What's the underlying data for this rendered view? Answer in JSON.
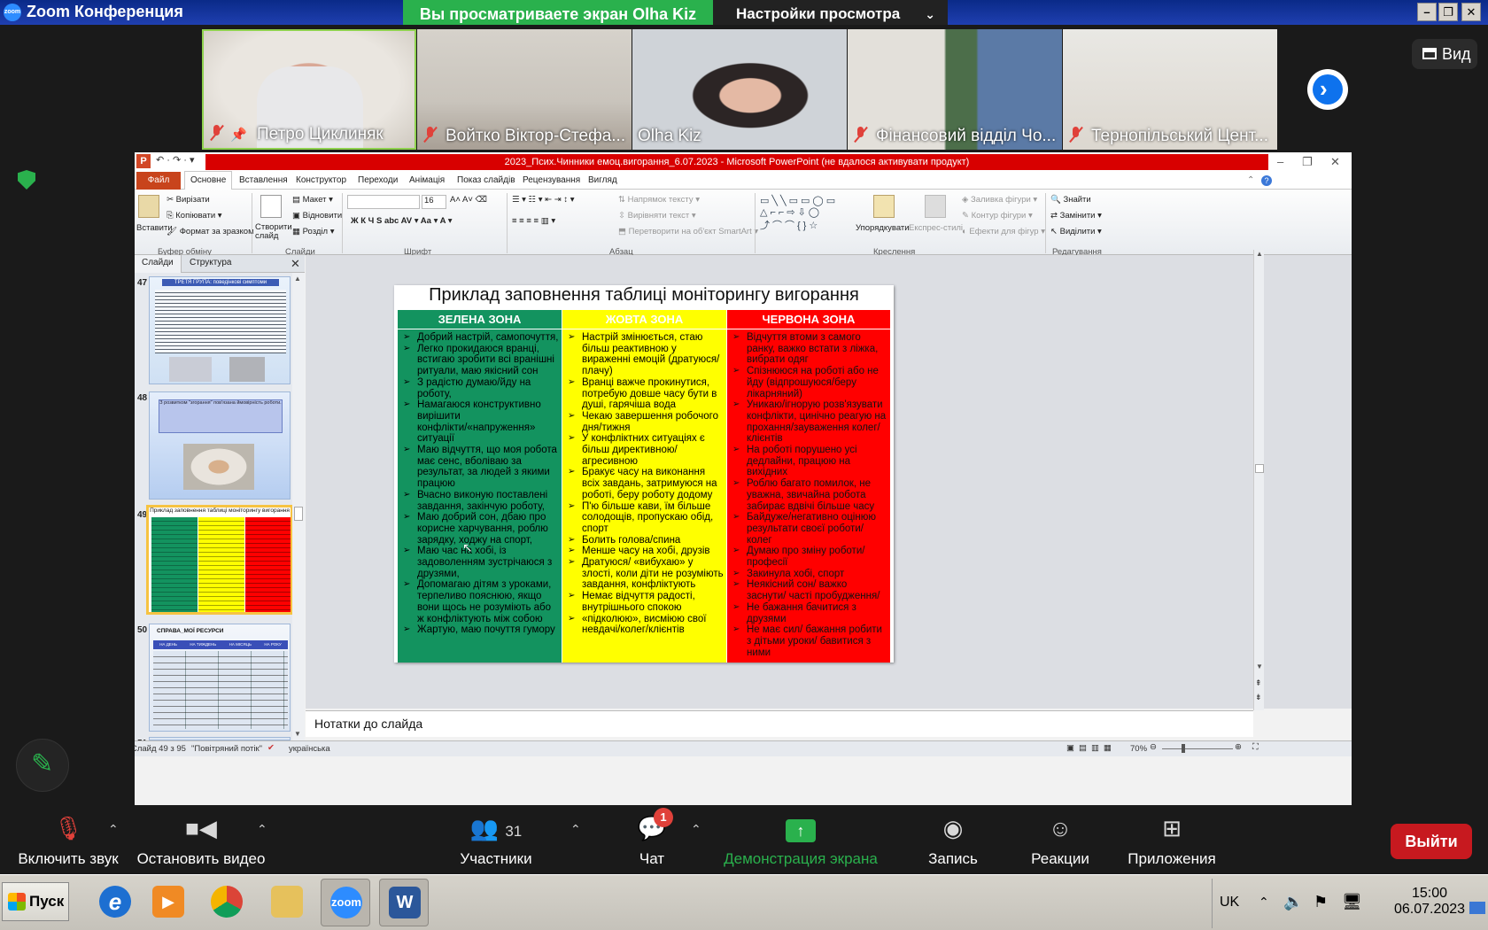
{
  "zoom": {
    "window_title": "Zoom Конференция",
    "logo_text": "zoom",
    "share_banner": "Вы просматриваете экран Olha Kiz",
    "view_settings": "Настройки просмотра",
    "view_button": "Вид",
    "participants": [
      {
        "name": "Петро Циклиняк",
        "muted": true,
        "pinned": true
      },
      {
        "name": "Войтко Віктор-Стефа...",
        "muted": true
      },
      {
        "name": "Olha Kiz",
        "muted": false
      },
      {
        "name": "Фінансовий відділ Чо...",
        "muted": true
      },
      {
        "name": "Тернопільський Цент...",
        "muted": true
      }
    ],
    "toolbar": {
      "mute_label": "Включить звук",
      "video_label": "Остановить видео",
      "participants_label": "Участники",
      "participants_count": "31",
      "chat_label": "Чат",
      "chat_badge": "1",
      "share_label": "Демонстрация экрана",
      "record_label": "Запись",
      "reactions_label": "Реакции",
      "apps_label": "Приложения",
      "leave_label": "Выйти"
    }
  },
  "ppt": {
    "window_title": "2023_Псих.Чинники емоц.вигорання_6.07.2023 - Microsoft PowerPoint (не вдалося активувати продукт)",
    "menu": [
      "Файл",
      "Основне",
      "Вставлення",
      "Конструктор",
      "Переходи",
      "Анімація",
      "Показ слайдів",
      "Рецензування",
      "Вигляд"
    ],
    "ribbon": {
      "paste": "Вставити",
      "cut": "Вирізати",
      "copy": "Копіювати",
      "format_painter": "Формат за зразком",
      "clipboard_group": "Буфер обміну",
      "new_slide": "Створити слайд",
      "layout": "Макет",
      "reset": "Відновити",
      "section": "Розділ",
      "slides_group": "Слайди",
      "font_size": "16",
      "font_group": "Шрифт",
      "text_direction": "Напрямок тексту",
      "align_text": "Вирівняти текст",
      "smartart": "Перетворити на об'єкт SmartArt",
      "paragraph_group": "Абзац",
      "arrange": "Упорядкувати",
      "quick_styles": "Експрес-стилі",
      "shape_fill": "Заливка фігури",
      "shape_outline": "Контур фігури",
      "shape_effects": "Ефекти для фігур",
      "drawing_group": "Креслення",
      "find": "Знайти",
      "replace": "Замінити",
      "select": "Виділити",
      "editing_group": "Редагування"
    },
    "panel_tabs": [
      "Слайди",
      "Структура"
    ],
    "thumbs": [
      {
        "num": "47",
        "title": "ТРЕТЯ ГРУПА: поведінкові симптоми"
      },
      {
        "num": "48",
        "title": "З розвитком \"згорання\" пов'язана ймовірність роботи."
      },
      {
        "num": "49",
        "title": "Приклад заповнення таблиці моніторингу вигорання"
      },
      {
        "num": "50",
        "title": "СПРАВА_МОЇ РЕСУРСИ",
        "cols": [
          "НА ДЕНЬ",
          "НА ТИЖДЕНЬ",
          "НА МІСЯЦЬ",
          "НА РОКУ"
        ]
      },
      {
        "num": "51"
      }
    ],
    "notes_placeholder": "Нотатки до слайда",
    "status": {
      "slide": "Слайд 49 з 95",
      "theme": "\"Повітряний потік\"",
      "lang": "українська",
      "zoom": "70%"
    }
  },
  "slide": {
    "title": "Приклад заповнення таблиці моніторингу вигорання",
    "zones": [
      {
        "header": "ЗЕЛЕНА ЗОНА",
        "items": [
          "Добрий настрій, самопочуття,",
          "Легко прокидаюся вранці, встигаю зробити всі вранішні ритуали, маю якісний сон",
          "З радістю думаю/йду на роботу,",
          "Намагаюся конструктивно вирішити конфлікти/«напруження» ситуації",
          "Маю відчуття, що моя робота має сенс, вболіваю за результат, за людей з якими працюю",
          "Вчасно виконую поставлені завдання, закінчую роботу,",
          "Маю добрий сон, дбаю про корисне харчування, роблю зарядку, ходжу на спорт,",
          "Маю час на хобі, із задоволенням зустрічаюся з друзями,",
          "Допомагаю дітям з уроками, терпеливо пояснюю, якщо вони щось не розуміють або ж конфліктують між собою",
          "Жартую, маю почуття гумору"
        ]
      },
      {
        "header": "ЖОВТА ЗОНА",
        "items": [
          "Настрій змінюється, стаю більш реактивною у вираженні емоцій (дратуюся/плачу)",
          "Вранці важче прокинутися, потребую довше часу бути в душі, гарячіша вода",
          "Чекаю завершення робочого дня/тижня",
          "У конфліктних ситуаціях є більш директивною/ агресивною",
          "Бракує часу на виконання всіх завдань, затримуюся на роботі, беру роботу додому",
          "П'ю більше кави, їм більше солодощів, пропускаю обід, спорт",
          "Болить голова/спина",
          "Менше часу на хобі, друзів",
          "Дратуюся/ «вибухаю» у злості, коли діти не розуміють завдання, конфліктують",
          "Немає відчуття радості, внутрішнього спокою",
          "«підколюю», висміюю свої невдачі/колег/клієнтів"
        ]
      },
      {
        "header": "ЧЕРВОНА ЗОНА",
        "items": [
          "Відчуття втоми з самого ранку,  важко встати з ліжка, вибрати одяг",
          "Спізнююся на роботі або не йду (відпрошуюся/беру лікарняний)",
          "Уникаю/ігнорую розв'язувати конфлікти, цинічно реагую на прохання/зауваження колег/клієнтів",
          "На роботі порушено усі дедлайни, працюю на вихідних",
          "Роблю багато помилок, не уважна, звичайна робота забирає вдвічі більше часу",
          "Байдуже/негативно оцінюю результати своєї роботи/колег",
          "Думаю про зміну роботи/професії",
          "Закинула хобі, спорт",
          "Неякісний сон/ важко заснути/ часті пробудження/",
          "Не бажання бачитися з друзями",
          "Не має сил/ бажання робити з дітьми уроки/ бавитися з ними"
        ]
      }
    ]
  },
  "taskbar": {
    "start": "Пуск",
    "apps": [
      {
        "name": "ie",
        "glyph": "e"
      },
      {
        "name": "media",
        "glyph": "▶"
      },
      {
        "name": "chrome",
        "glyph": ""
      },
      {
        "name": "explorer",
        "glyph": ""
      },
      {
        "name": "zoom",
        "glyph": "zoom"
      },
      {
        "name": "word",
        "glyph": "W"
      }
    ],
    "lang": "UK",
    "time": "15:00",
    "date": "06.07.2023"
  }
}
